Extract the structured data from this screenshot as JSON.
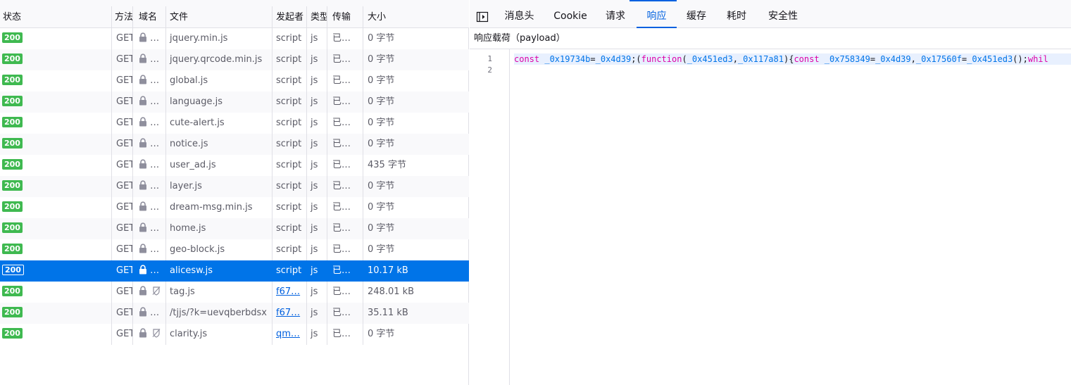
{
  "network": {
    "columns": {
      "status": "状态",
      "method": "方法",
      "domain": "域名",
      "file": "文件",
      "initiator": "发起者",
      "type": "类型",
      "transferred": "传输",
      "size": "大小"
    },
    "requests": [
      {
        "status": "200",
        "method": "GET",
        "file": "jquery.min.js",
        "initiator": "script",
        "type": "js",
        "transferred": "已…",
        "size": "0 字节"
      },
      {
        "status": "200",
        "method": "GET",
        "file": "jquery.qrcode.min.js",
        "initiator": "script",
        "type": "js",
        "transferred": "已…",
        "size": "0 字节"
      },
      {
        "status": "200",
        "method": "GET",
        "file": "global.js",
        "initiator": "script",
        "type": "js",
        "transferred": "已…",
        "size": "0 字节"
      },
      {
        "status": "200",
        "method": "GET",
        "file": "language.js",
        "initiator": "script",
        "type": "js",
        "transferred": "已…",
        "size": "0 字节"
      },
      {
        "status": "200",
        "method": "GET",
        "file": "cute-alert.js",
        "initiator": "script",
        "type": "js",
        "transferred": "已…",
        "size": "0 字节"
      },
      {
        "status": "200",
        "method": "GET",
        "file": "notice.js",
        "initiator": "script",
        "type": "js",
        "transferred": "已…",
        "size": "0 字节"
      },
      {
        "status": "200",
        "method": "GET",
        "file": "user_ad.js",
        "initiator": "script",
        "type": "js",
        "transferred": "已…",
        "size": "435 字节"
      },
      {
        "status": "200",
        "method": "GET",
        "file": "layer.js",
        "initiator": "script",
        "type": "js",
        "transferred": "已…",
        "size": "0 字节"
      },
      {
        "status": "200",
        "method": "GET",
        "file": "dream-msg.min.js",
        "initiator": "script",
        "type": "js",
        "transferred": "已…",
        "size": "0 字节"
      },
      {
        "status": "200",
        "method": "GET",
        "file": "home.js",
        "initiator": "script",
        "type": "js",
        "transferred": "已…",
        "size": "0 字节"
      },
      {
        "status": "200",
        "method": "GET",
        "file": "geo-block.js",
        "initiator": "script",
        "type": "js",
        "transferred": "已…",
        "size": "0 字节"
      },
      {
        "status": "200",
        "method": "GET",
        "file": "alicesw.js",
        "initiator": "script",
        "type": "js",
        "transferred": "已…",
        "size": "10.17 kB",
        "selected": true
      },
      {
        "status": "200",
        "method": "GET",
        "file": "tag.js",
        "initiator": "f67…",
        "initiator_link": true,
        "tracker": true,
        "type": "js",
        "transferred": "已…",
        "size": "248.01 kB"
      },
      {
        "status": "200",
        "method": "GET",
        "file": "/tjjs/?k=uevqberbdsx",
        "initiator": "f67…",
        "initiator_link": true,
        "type": "js",
        "transferred": "已…",
        "size": "35.11 kB"
      },
      {
        "status": "200",
        "method": "GET",
        "file": "clarity.js",
        "initiator": "qm…",
        "initiator_link": true,
        "tracker": true,
        "type": "js",
        "transferred": "已…",
        "size": "0 字节"
      }
    ]
  },
  "details": {
    "tabs": [
      "消息头",
      "Cookie",
      "请求",
      "响应",
      "缓存",
      "耗时",
      "安全性"
    ],
    "active_tab": "响应",
    "payload_header": "响应载荷（payload）",
    "editor": {
      "line_numbers": [
        "1",
        "2"
      ],
      "line1_tokens": [
        {
          "k": "kw",
          "t": "const"
        },
        {
          "k": "pn",
          "t": " "
        },
        {
          "k": "id",
          "t": "_0x19734b"
        },
        {
          "k": "pn",
          "t": "="
        },
        {
          "k": "id",
          "t": "_0x4d39"
        },
        {
          "k": "pn",
          "t": ";("
        },
        {
          "k": "kw",
          "t": "function"
        },
        {
          "k": "pn",
          "t": "("
        },
        {
          "k": "id",
          "t": "_0x451ed3"
        },
        {
          "k": "pn",
          "t": ","
        },
        {
          "k": "id",
          "t": "_0x117a81"
        },
        {
          "k": "pn",
          "t": "){"
        },
        {
          "k": "kw",
          "t": "const"
        },
        {
          "k": "pn",
          "t": " "
        },
        {
          "k": "id",
          "t": "_0x758349"
        },
        {
          "k": "pn",
          "t": "="
        },
        {
          "k": "id",
          "t": "_0x4d39"
        },
        {
          "k": "pn",
          "t": ","
        },
        {
          "k": "id",
          "t": "_0x17560f"
        },
        {
          "k": "pn",
          "t": "="
        },
        {
          "k": "id",
          "t": "_0x451ed3"
        },
        {
          "k": "pn",
          "t": "();"
        },
        {
          "k": "kw",
          "t": "whil"
        }
      ]
    }
  },
  "colors": {
    "accent": "#0061e0",
    "selected_row": "#0074e8",
    "status_ok": "#3fb950",
    "keyword": "#dd00a9",
    "identifier": "#0074e8"
  }
}
